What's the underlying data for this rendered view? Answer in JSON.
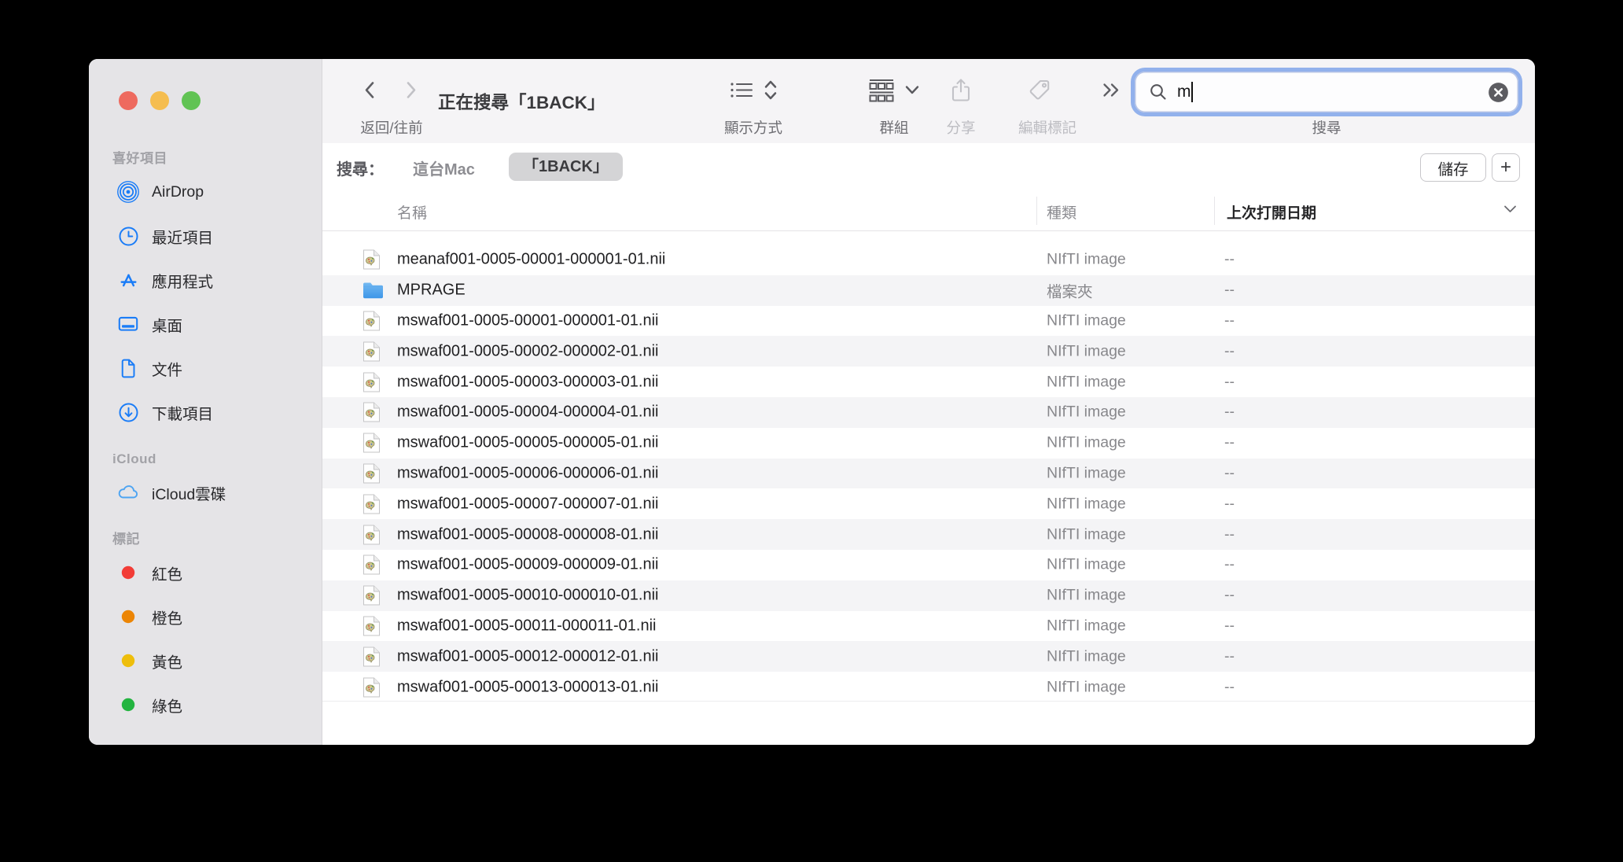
{
  "window": {
    "title": "正在搜尋「1BACK」"
  },
  "traffic_lights": {
    "close_color": "#ee6a5f",
    "minimize_color": "#f5bd4f",
    "zoom_color": "#61c354"
  },
  "toolbar": {
    "back_forward_label": "返回/往前",
    "view_label": "顯示方式",
    "group_label": "群組",
    "share_label": "分享",
    "tags_label": "編輯標記",
    "search_label": "搜尋",
    "search_value": "m"
  },
  "scope_bar": {
    "prefix": "搜尋：",
    "scope_mac": "這台Mac",
    "scope_selected": "「1BACK」",
    "save_label": "儲存",
    "add_label": "+"
  },
  "table": {
    "columns": [
      {
        "label": "名稱",
        "sorted": false
      },
      {
        "label": "種類",
        "sorted": false
      },
      {
        "label": "上次打開日期",
        "sorted": true,
        "sort_indicator": "down"
      }
    ]
  },
  "files": [
    {
      "name": "meanaf001-0005-00001-000001-01.nii",
      "kind": "NIfTI image",
      "date": "--",
      "icon": "nifti-file-icon"
    },
    {
      "name": "MPRAGE",
      "kind": "檔案夾",
      "date": "--",
      "icon": "folder-icon"
    },
    {
      "name": "mswaf001-0005-00001-000001-01.nii",
      "kind": "NIfTI image",
      "date": "--",
      "icon": "nifti-file-icon"
    },
    {
      "name": "mswaf001-0005-00002-000002-01.nii",
      "kind": "NIfTI image",
      "date": "--",
      "icon": "nifti-file-icon"
    },
    {
      "name": "mswaf001-0005-00003-000003-01.nii",
      "kind": "NIfTI image",
      "date": "--",
      "icon": "nifti-file-icon"
    },
    {
      "name": "mswaf001-0005-00004-000004-01.nii",
      "kind": "NIfTI image",
      "date": "--",
      "icon": "nifti-file-icon"
    },
    {
      "name": "mswaf001-0005-00005-000005-01.nii",
      "kind": "NIfTI image",
      "date": "--",
      "icon": "nifti-file-icon"
    },
    {
      "name": "mswaf001-0005-00006-000006-01.nii",
      "kind": "NIfTI image",
      "date": "--",
      "icon": "nifti-file-icon"
    },
    {
      "name": "mswaf001-0005-00007-000007-01.nii",
      "kind": "NIfTI image",
      "date": "--",
      "icon": "nifti-file-icon"
    },
    {
      "name": "mswaf001-0005-00008-000008-01.nii",
      "kind": "NIfTI image",
      "date": "--",
      "icon": "nifti-file-icon"
    },
    {
      "name": "mswaf001-0005-00009-000009-01.nii",
      "kind": "NIfTI image",
      "date": "--",
      "icon": "nifti-file-icon"
    },
    {
      "name": "mswaf001-0005-00010-000010-01.nii",
      "kind": "NIfTI image",
      "date": "--",
      "icon": "nifti-file-icon"
    },
    {
      "name": "mswaf001-0005-00011-000011-01.nii",
      "kind": "NIfTI image",
      "date": "--",
      "icon": "nifti-file-icon"
    },
    {
      "name": "mswaf001-0005-00012-000012-01.nii",
      "kind": "NIfTI image",
      "date": "--",
      "icon": "nifti-file-icon"
    },
    {
      "name": "mswaf001-0005-00013-000013-01.nii",
      "kind": "NIfTI image",
      "date": "--",
      "icon": "nifti-file-icon"
    }
  ],
  "sidebar": {
    "sections": [
      {
        "title": "喜好項目",
        "items": [
          {
            "label": "AirDrop",
            "icon": "airdrop-icon"
          },
          {
            "label": "最近項目",
            "icon": "clock-icon"
          },
          {
            "label": "應用程式",
            "icon": "appstore-icon"
          },
          {
            "label": "桌面",
            "icon": "desktop-icon"
          },
          {
            "label": "文件",
            "icon": "document-icon"
          },
          {
            "label": "下載項目",
            "icon": "download-icon"
          }
        ]
      },
      {
        "title": "iCloud",
        "items": [
          {
            "label": "iCloud雲碟",
            "icon": "cloud-icon"
          }
        ]
      },
      {
        "title": "標記",
        "items": [
          {
            "label": "紅色",
            "icon": "tag-red-icon",
            "color": "#f23c37"
          },
          {
            "label": "橙色",
            "icon": "tag-orange-icon",
            "color": "#ec8505"
          },
          {
            "label": "黃色",
            "icon": "tag-yellow-icon",
            "color": "#eebe0c"
          },
          {
            "label": "綠色",
            "icon": "tag-green-icon",
            "color": "#23b440"
          }
        ]
      }
    ]
  },
  "colors": {
    "accent_blue": "#1a7cf7",
    "focus_ring": "#92b1ec",
    "sidebar_bg": "#e5e4e7",
    "toolbar_bg": "#f5f4f6",
    "row_alt_bg": "#f4f4f6"
  }
}
